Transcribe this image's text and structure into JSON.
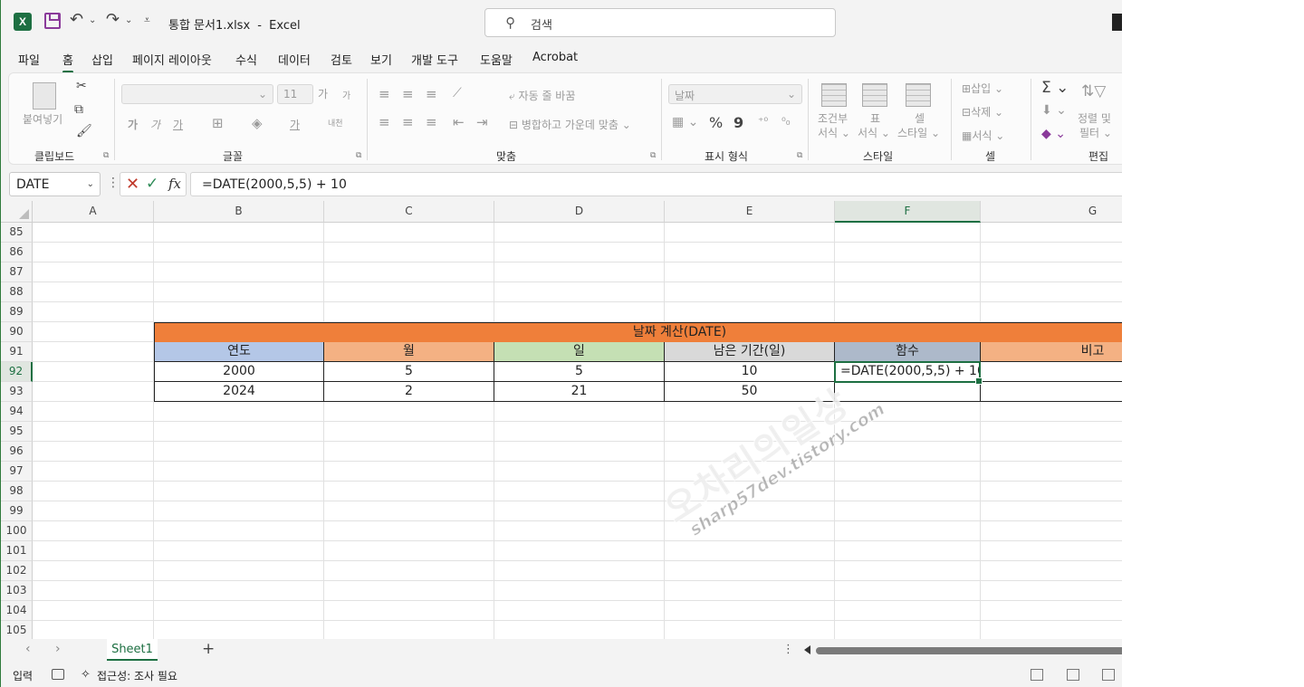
{
  "window": {
    "file_title": "통합 문서1.xlsx",
    "separator": "-",
    "app_name": "Excel",
    "search_placeholder": "검색",
    "app_logo_letter": "X"
  },
  "menu_tabs": [
    "파일",
    "홈",
    "삽입",
    "페이지 레이아웃",
    "수식",
    "데이터",
    "검토",
    "보기",
    "개발 도구",
    "도움말",
    "Acrobat"
  ],
  "active_menu_tab": "홈",
  "ribbon": {
    "clipboard": {
      "paste": "붙여넣기",
      "label": "클립보드"
    },
    "font": {
      "size": "11",
      "bold": "가",
      "italic": "가",
      "underline": "가",
      "grow": "가",
      "shrink": "가",
      "phonetic": "내천",
      "fill": "가",
      "label": "글꼴"
    },
    "alignment": {
      "wrap": "자동 줄 바꿈",
      "merge": "병합하고 가운데 맞춤",
      "label": "맞춤"
    },
    "number": {
      "format": "날짜",
      "percent": "%",
      "comma": "9",
      "label": "표시 형식"
    },
    "styles": {
      "conditional_1": "조건부",
      "conditional_2": "서식",
      "table_1": "표",
      "table_2": "서식",
      "cell_1": "셀",
      "cell_2": "스타일",
      "label": "스타일"
    },
    "cells": {
      "insert": "삽입",
      "delete": "삭제",
      "format": "서식",
      "label": "셀"
    },
    "editing": {
      "sort_1": "정렬 및",
      "sort_2": "필터",
      "label": "편집"
    }
  },
  "formula_bar": {
    "name_box": "DATE",
    "formula": "=DATE(2000,5,5)  + 10"
  },
  "columns": [
    "A",
    "B",
    "C",
    "D",
    "E",
    "F",
    "G"
  ],
  "selected_column": "F",
  "rows": [
    "85",
    "86",
    "87",
    "88",
    "89",
    "90",
    "91",
    "92",
    "93",
    "94",
    "95",
    "96",
    "97",
    "98",
    "99",
    "100",
    "101",
    "102",
    "103",
    "104",
    "105"
  ],
  "selected_row": "92",
  "table": {
    "title": "날짜 계산(DATE)",
    "title_color": "#ef7f3a",
    "headers": [
      {
        "label": "연도",
        "color": "#b4c7e7"
      },
      {
        "label": "월",
        "color": "#f4b183"
      },
      {
        "label": "일",
        "color": "#c5e0b4"
      },
      {
        "label": "남은 기간(일)",
        "color": "#d9d9d9"
      },
      {
        "label": "함수",
        "color": "#adb9ca"
      },
      {
        "label": "비고",
        "color": "#f4b183"
      }
    ],
    "rows": [
      [
        "2000",
        "5",
        "5",
        "10",
        "=DATE(2000,5,5)  + 10",
        ""
      ],
      [
        "2024",
        "2",
        "21",
        "50",
        "",
        ""
      ]
    ]
  },
  "watermark": {
    "main": "오차리의일상",
    "sub": "sharp57dev.tistory.com"
  },
  "sheets": [
    "Sheet1"
  ],
  "add_sheet": "+",
  "status": {
    "mode": "입력",
    "accessibility": "접근성: 조사 필요"
  },
  "accent_color": "#1d6f42"
}
